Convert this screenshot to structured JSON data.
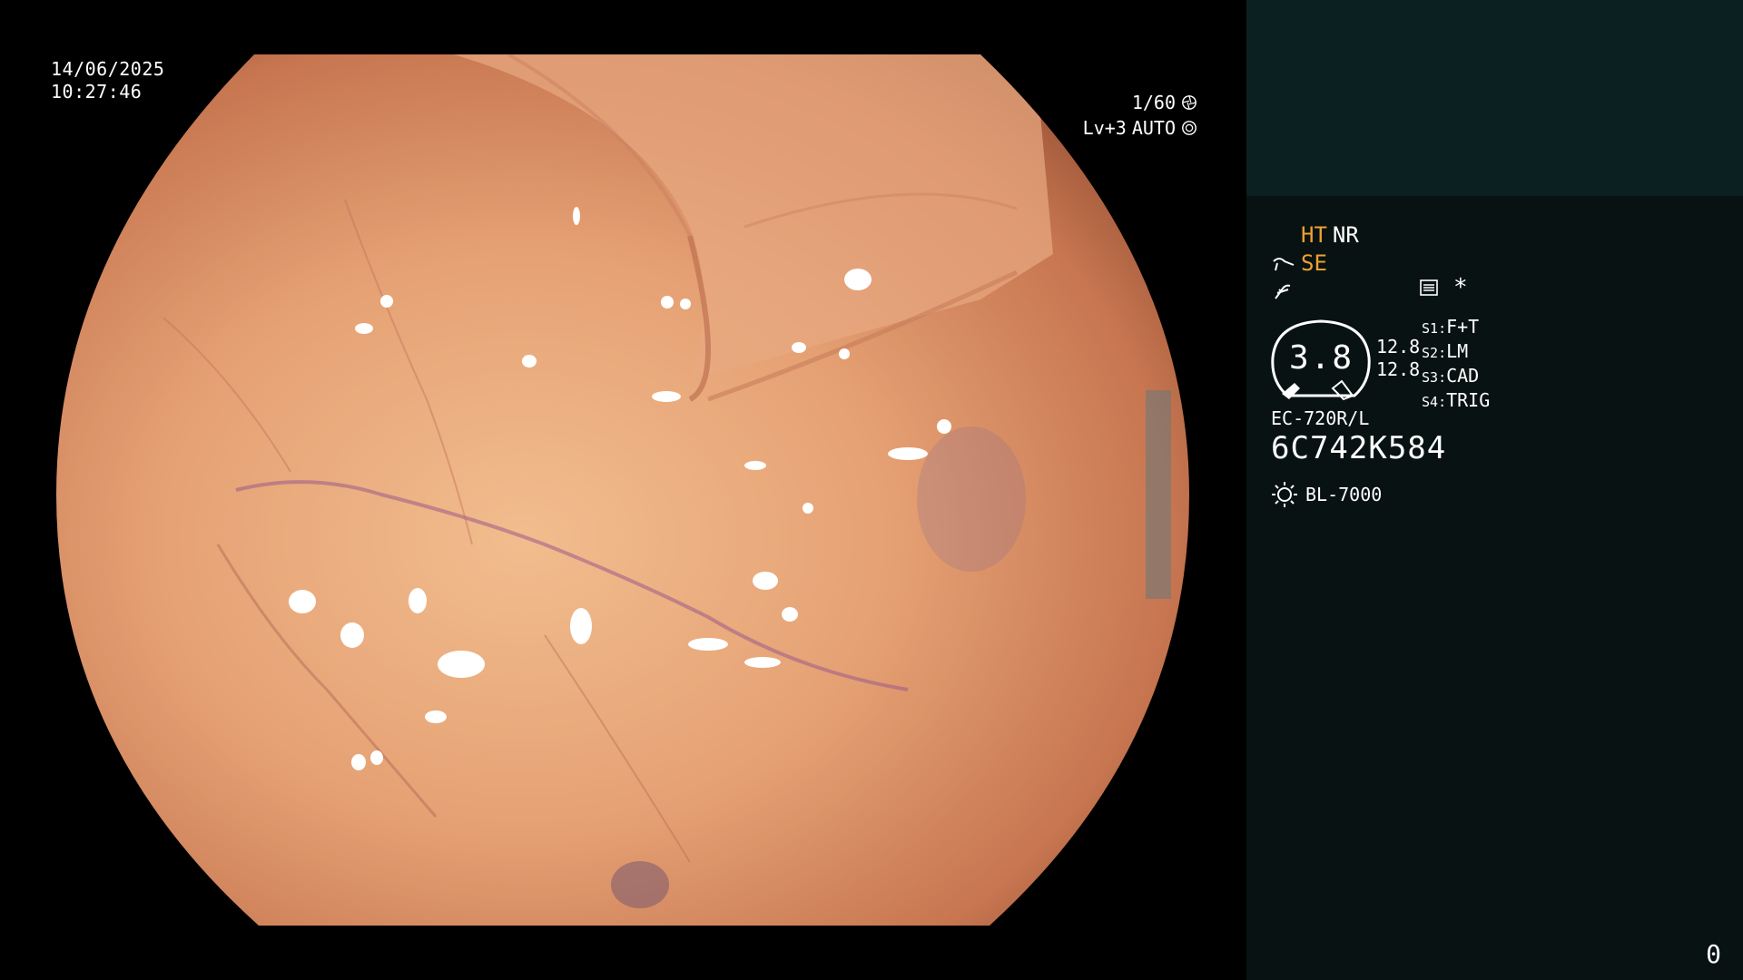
{
  "overlay": {
    "date": "14/06/2025",
    "time": "10:27:46",
    "shutter": "1/60",
    "iris_level": "Lv+3",
    "iris_mode": "AUTO",
    "icons": [
      "shutter-icon",
      "iris-icon"
    ]
  },
  "status_panel": {
    "modes": {
      "ht": "HT",
      "nr": "NR",
      "se": "SE",
      "icons": [
        "se-mode-icon",
        "enhancement-icon",
        "settings-list-icon"
      ],
      "asterisk": "*"
    },
    "gauge_value": "3.8",
    "values": [
      "12.8",
      "12.8"
    ],
    "switches": [
      {
        "key": "S1",
        "value": "F+T"
      },
      {
        "key": "S2",
        "value": "LM"
      },
      {
        "key": "S3",
        "value": "CAD"
      },
      {
        "key": "S4",
        "value": "TRIG"
      }
    ],
    "scope_model": "EC-720R/L",
    "serial_number": "6C742K584",
    "light_source": "BL-7000",
    "counter": "0"
  },
  "colors": {
    "background": "#000000",
    "panel": "#081212",
    "panel_top": "#0b2020",
    "accent_orange": "#f0a030",
    "text": "#ffffff"
  }
}
